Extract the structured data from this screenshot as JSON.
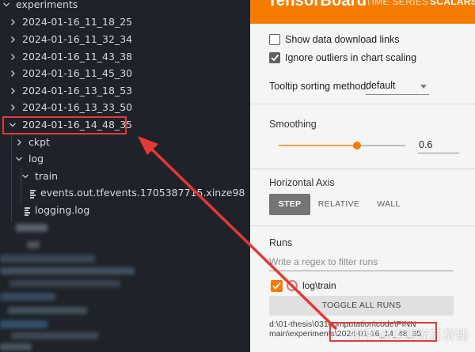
{
  "explorer": {
    "root_label": "experiments",
    "folders": [
      "2024-01-16_11_18_25",
      "2024-01-16_11_32_34",
      "2024-01-16_11_43_38",
      "2024-01-16_11_45_30",
      "2024-01-16_13_18_53",
      "2024-01-16_13_33_50",
      "2024-01-16_14_48_35"
    ],
    "ckpt": "ckpt",
    "log": "log",
    "train": "train",
    "events_file": "events.out.tfevents.1705387715.xinze98",
    "logging_file": "logging.log"
  },
  "tensorboard": {
    "title": "TensorBoard",
    "tab_time_series": "TIME SERIES",
    "tab_scalars": "SCALARS",
    "show_download_links": "Show data download links",
    "ignore_outliers": "Ignore outliers in chart scaling",
    "tooltip_sort_label": "Tooltip sorting method:",
    "tooltip_sort_value": "default",
    "smoothing_title": "Smoothing",
    "smoothing_value": "0.6",
    "smoothing_level": 0.6,
    "horizontal_axis_title": "Horizontal Axis",
    "axis_step": "STEP",
    "axis_relative": "RELATIVE",
    "axis_wall": "WALL",
    "runs_title": "Runs",
    "runs_filter_placeholder": "Write a regex to filter runs",
    "run_label": "log\\train",
    "toggle_all": "TOGGLE ALL RUNS",
    "run_path_line1": "d:\\01-thesis\\031computation\\code\\PINN",
    "run_path_line2": "main\\experiments\\2024-01-16_14_48_35",
    "watermark": "知乎 @柒柒流苏货铺"
  },
  "colors": {
    "accent": "#f57c00",
    "highlight": "#e53935"
  },
  "icons": {
    "chevron_right": "chevron-right-icon",
    "chevron_down": "chevron-down-icon",
    "file": "file-lines-icon"
  }
}
